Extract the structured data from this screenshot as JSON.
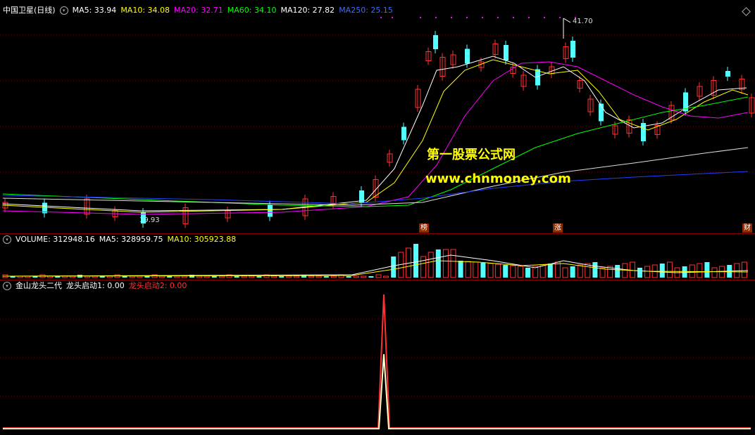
{
  "main": {
    "title": "中国卫星(日线)",
    "ma": [
      {
        "label": "MA5: 33.94",
        "color": "#ffffff"
      },
      {
        "label": "MA10: 34.08",
        "color": "#ffff00"
      },
      {
        "label": "MA20: 32.71",
        "color": "#ff00ff"
      },
      {
        "label": "MA60: 34.10",
        "color": "#00ff00"
      },
      {
        "label": "MA120: 27.82",
        "color": "#ffffff"
      },
      {
        "label": "MA250: 25.15",
        "color": "#0000ff"
      }
    ],
    "high_label": "41.70",
    "low_label": "19.93",
    "tags": [
      "榜",
      "涨",
      "财"
    ],
    "watermark_line1": "第一股票公式网",
    "watermark_line2": "www.chnmoney.com"
  },
  "volume": {
    "label": "VOLUME: 312948.16",
    "ma5": "MA5: 328959.75",
    "ma10": "MA10: 305923.88"
  },
  "indicator": {
    "name": "金山龙头二代",
    "line1": "龙头启动1: 0.00",
    "line2": "龙头启动2: 0.00"
  },
  "colors": {
    "up": "#ff3232",
    "down": "#54ffff",
    "bg": "#000000"
  }
}
